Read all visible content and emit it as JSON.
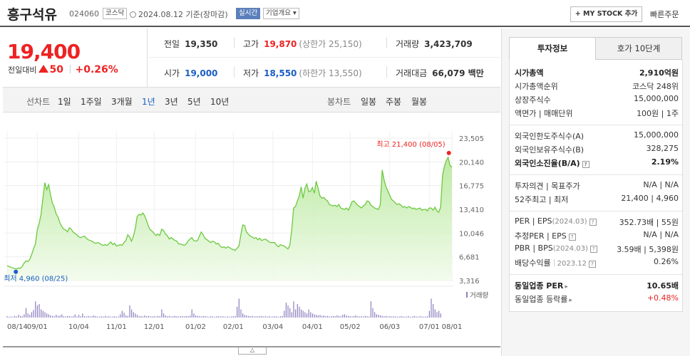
{
  "header": {
    "name": "흥구석유",
    "code": "024060",
    "market": "코스닥",
    "date_text": "2024.08.12 기준(장마감)",
    "live_tag": "실시간",
    "company_tag": "기업개요 ▾",
    "mystock_label": "+ MY STOCK 추가",
    "quick_order": "빠른주문"
  },
  "price": {
    "current": "19,400",
    "change_label": "전일대비",
    "change": "50",
    "change_pct": "+0.26%"
  },
  "summary": {
    "prev_label": "전일",
    "prev": "19,350",
    "high_label": "고가",
    "high": "19,870",
    "upper_limit": "(상한가 25,150)",
    "volume_label": "거래량",
    "volume": "3,423,709",
    "open_label": "시가",
    "open": "19,000",
    "low_label": "저가",
    "low": "18,550",
    "lower_limit": "(하한가 13,550)",
    "amount_label": "거래대금",
    "amount": "66,079 백만"
  },
  "periods": {
    "line_chart": "선차트",
    "items": [
      "1일",
      "1주일",
      "3개월",
      "1년",
      "3년",
      "5년",
      "10년"
    ],
    "selected": "1년",
    "candle_chart": "봉차트",
    "candle_items": [
      "일봉",
      "주봉",
      "월봉"
    ]
  },
  "chart_data": {
    "type": "area",
    "x_ticks": [
      "08/14",
      "09/01",
      "10/04",
      "11/01",
      "12/01",
      "01/02",
      "02/01",
      "03/04",
      "04/01",
      "05/02",
      "06/03",
      "07/01",
      "08/01"
    ],
    "y_ticks": [
      23505,
      20140,
      16775,
      13410,
      10046,
      6681,
      3316
    ],
    "ylim": [
      3316,
      23505
    ],
    "high_label": "최고 21,400 (08/05)",
    "low_label": "최저 4,960 (08/25)",
    "volume_legend": "거래량",
    "line_color": "#6cc93f",
    "price_series": [
      5400,
      5300,
      5200,
      5100,
      5000,
      4960,
      5100,
      5050,
      5300,
      5800,
      6100,
      6000,
      6300,
      7000,
      7800,
      8500,
      10500,
      11400,
      12700,
      15000,
      17200,
      16200,
      16900,
      15500,
      14300,
      13700,
      12800,
      12300,
      11500,
      11000,
      10600,
      10500,
      10200,
      10800,
      10600,
      10200,
      10000,
      9800,
      9500,
      9400,
      9500,
      9600,
      9300,
      9100,
      9000,
      8900,
      8700,
      8600,
      8700,
      8600,
      8400,
      8300,
      8400,
      8300,
      8500,
      8800,
      8400,
      8600,
      8200,
      8300,
      8400,
      8300,
      8700,
      9000,
      9800,
      9500,
      8900,
      9600,
      10700,
      12400,
      12700,
      12600,
      12900,
      12500,
      11800,
      11000,
      10500,
      10300,
      10000,
      9700,
      9900,
      9700,
      10600,
      10400,
      9900,
      9700,
      9200,
      9400,
      9200,
      9000,
      8900,
      8500,
      8500,
      8400,
      8300,
      8500,
      8900,
      9200,
      9400,
      9000,
      8900,
      9000,
      9600,
      10200,
      9800,
      9300,
      9100,
      8900,
      8700,
      8900,
      8800,
      8500,
      8600,
      8200,
      8000,
      8100,
      7900,
      8100,
      8000,
      7800,
      7700,
      7600,
      7900,
      8200,
      9800,
      11200,
      11100,
      10200,
      9900,
      9600,
      9500,
      9300,
      9400,
      9100,
      9300,
      9000,
      9100,
      9200,
      9000,
      8800,
      8700,
      8700,
      8700,
      8300,
      8100,
      8400,
      8300,
      8200,
      8000,
      7800,
      8300,
      10500,
      13600,
      13800,
      14600,
      15300,
      16600,
      15000,
      16400,
      17000,
      15900,
      16000,
      16500,
      15700,
      17400,
      16400,
      15300,
      15000,
      15100,
      14800,
      14600,
      14100,
      14000,
      13900,
      14000,
      13800,
      14100,
      13600,
      13500,
      13400,
      13600,
      13300,
      13800,
      14500,
      14600,
      14300,
      14000,
      13800,
      13600,
      13900,
      14100,
      14600,
      14500,
      14000,
      13800,
      13600,
      13500,
      13400,
      14100,
      19000,
      17600,
      16600,
      16000,
      15400,
      14800,
      14600,
      14300,
      14100,
      14200,
      14000,
      13700,
      13800,
      13600,
      13800,
      13700,
      13500,
      13600,
      13400,
      13500,
      13600,
      13300,
      13400,
      13400,
      13200,
      13600,
      13600,
      13300,
      13700,
      13200,
      13000,
      13700,
      18200,
      19500,
      20300,
      20800,
      19600,
      19400
    ],
    "volume_bars": [
      0.05,
      0.03,
      0.04,
      0.03,
      0.06,
      0.04,
      0.1,
      0.06,
      0.05,
      0.12,
      0.35,
      0.15,
      0.1,
      0.2,
      0.28,
      0.6,
      0.45,
      0.5,
      0.3,
      0.25,
      0.2,
      0.15,
      0.12,
      0.08,
      0.06,
      0.05,
      0.1,
      0.06,
      0.08,
      0.12,
      0.05,
      0.04,
      0.06,
      0.05,
      0.04,
      0.05,
      0.12,
      0.04,
      0.1,
      0.05,
      0.15,
      0.05,
      0.04,
      0.06,
      0.04,
      0.05,
      0.08,
      0.05,
      0.04,
      0.03,
      0.05,
      0.04,
      0.06,
      0.04,
      0.05,
      0.03,
      0.04,
      0.05,
      0.03,
      0.04,
      0.12,
      0.25,
      0.18,
      0.08,
      0.06,
      0.45,
      0.3,
      0.2,
      0.15,
      0.1,
      0.05,
      0.06,
      0.04,
      0.08,
      0.05,
      0.06,
      0.05,
      0.04,
      0.05,
      0.04,
      0.06,
      0.05,
      0.3,
      0.15,
      0.08,
      0.05,
      0.06,
      0.04,
      0.05,
      0.06,
      0.05,
      0.04,
      0.05,
      0.06,
      0.04,
      0.06,
      0.05,
      0.07,
      0.3,
      0.15,
      0.08,
      0.06,
      0.05,
      0.04,
      0.06,
      0.05,
      0.04,
      0.03,
      0.05,
      0.04,
      0.03,
      0.04,
      0.05,
      0.04,
      0.05,
      0.04,
      0.03,
      0.04,
      0.03,
      0.04,
      0.05,
      0.06,
      0.4,
      0.7,
      0.3,
      0.15,
      0.1,
      0.08,
      0.06,
      0.05,
      0.06,
      0.04,
      0.05,
      0.04,
      0.05,
      0.06,
      0.04,
      0.05,
      0.04,
      0.05,
      0.03,
      0.04,
      0.05,
      0.04,
      0.03,
      0.05,
      0.06,
      0.25,
      0.55,
      0.45,
      0.35,
      0.2,
      0.6,
      0.3,
      0.5,
      0.4,
      0.3,
      0.25,
      0.2,
      0.15,
      0.3,
      0.2,
      0.15,
      0.12,
      0.1,
      0.08,
      0.1,
      0.06,
      0.08,
      0.05,
      0.06,
      0.04,
      0.05,
      0.06,
      0.05,
      0.08,
      0.06,
      0.05,
      0.1,
      0.12,
      0.08,
      0.06,
      0.05,
      0.04,
      0.06,
      0.08,
      0.05,
      0.04,
      0.05,
      0.04,
      0.06,
      0.05,
      0.04,
      0.6,
      0.35,
      0.2,
      0.12,
      0.1,
      0.08,
      0.06,
      0.05,
      0.06,
      0.04,
      0.05,
      0.04,
      0.05,
      0.04,
      0.03,
      0.04,
      0.05,
      0.04,
      0.03,
      0.04,
      0.05,
      0.03,
      0.04,
      0.06,
      0.04,
      0.03,
      0.05,
      0.04,
      0.03,
      0.04,
      0.05,
      0.25,
      0.7,
      0.5,
      0.3,
      0.2,
      0.25,
      0.15
    ]
  },
  "side": {
    "tab_invest": "투자정보",
    "tab_hoga": "호가 10단계",
    "market_cap_label": "시가총액",
    "market_cap": "2,910억원",
    "market_cap_rank_label": "시가총액순위",
    "market_cap_rank": "코스닥 248위",
    "shares_label": "상장주식수",
    "shares": "15,000,000",
    "par_label": "액면가 | 매매단위",
    "par": "100원 | 1주",
    "foreign_limit_label": "외국인한도주식수(A)",
    "foreign_limit": "15,000,000",
    "foreign_hold_label": "외국인보유주식수(B)",
    "foreign_hold": "328,275",
    "foreign_rate_label": "외국인소진율(B/A)",
    "foreign_rate": "2.19%",
    "opinion_label": "투자의견 | 목표주가",
    "opinion": "N/A | N/A",
    "w52_label": "52주최고 | 최저",
    "w52": "21,400 | 4,960",
    "per_label": "PER | EPS",
    "per_date": "(2024.03)",
    "per": "352.73배 | 55원",
    "est_per_label": "추정PER | EPS",
    "est_per": "N/A | N/A",
    "pbr_label": "PBR | BPS",
    "pbr_date": "(2024.03)",
    "pbr": "3.59배 | 5,398원",
    "div_label": "배당수익률",
    "div_date": "2023.12",
    "div": "0.26%",
    "sector_per_label": "동일업종 PER",
    "sector_per": "10.65배",
    "sector_rate_label": "동일업종 등락률",
    "sector_rate": "+0.48%",
    "help_mark": "?"
  }
}
